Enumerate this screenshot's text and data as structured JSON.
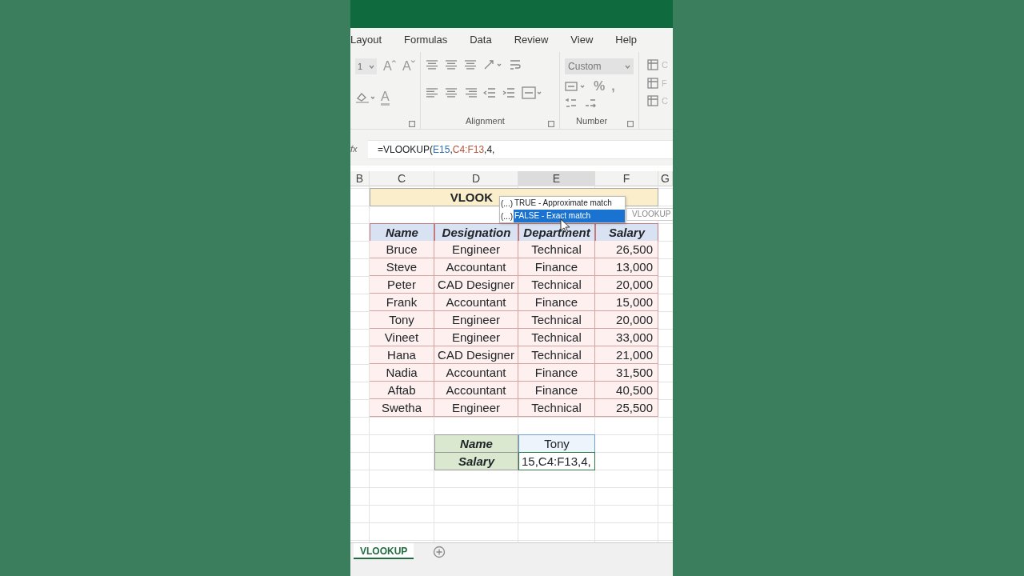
{
  "ribbon_tabs": [
    {
      "label": "Layout"
    },
    {
      "label": "Formulas"
    },
    {
      "label": "Data"
    },
    {
      "label": "Review"
    },
    {
      "label": "View"
    },
    {
      "label": "Help"
    }
  ],
  "ribbon": {
    "font_size": "1",
    "font_glyphs": [
      "Aˆ",
      "Aˇ"
    ],
    "font_color_glyph": "A",
    "number_format": "Custom",
    "number_glyphs": [
      "%",
      ","
    ],
    "group_labels": [
      "Alignment",
      "Number"
    ],
    "style_letters": [
      "C",
      "F",
      "C"
    ]
  },
  "formula_bar": {
    "fx": "fx",
    "parts": [
      {
        "text": "=VLOOKUP("
      },
      {
        "text": "E15",
        "color": "#2e6db4"
      },
      {
        "text": ","
      },
      {
        "text": "C4:F13",
        "color": "#b4543a"
      },
      {
        "text": ",4,"
      }
    ]
  },
  "column_headers": [
    {
      "label": "B",
      "selected": false
    },
    {
      "label": "C",
      "selected": false
    },
    {
      "label": "D",
      "selected": false
    },
    {
      "label": "E",
      "selected": true
    },
    {
      "label": "F",
      "selected": false
    },
    {
      "label": "G",
      "selected": false
    }
  ],
  "title_cell": "VLOOK",
  "autocomplete": {
    "options": [
      {
        "icon": "(...)",
        "label": "TRUE - Approximate match",
        "selected": false
      },
      {
        "icon": "(...)",
        "label": "FALSE - Exact match",
        "selected": true
      }
    ],
    "tooltip": "VLOOKUP"
  },
  "table": {
    "columns": [
      "Name",
      "Designation",
      "Department",
      "Salary"
    ],
    "rows": [
      [
        "Bruce",
        "Engineer",
        "Technical",
        "26,500"
      ],
      [
        "Steve",
        "Accountant",
        "Finance",
        "13,000"
      ],
      [
        "Peter",
        "CAD Designer",
        "Technical",
        "20,000"
      ],
      [
        "Frank",
        "Accountant",
        "Finance",
        "15,000"
      ],
      [
        "Tony",
        "Engineer",
        "Technical",
        "20,000"
      ],
      [
        "Vineet",
        "Engineer",
        "Technical",
        "33,000"
      ],
      [
        "Hana",
        "CAD Designer",
        "Technical",
        "21,000"
      ],
      [
        "Nadia",
        "Accountant",
        "Finance",
        "31,500"
      ],
      [
        "Aftab",
        "Accountant",
        "Finance",
        "40,500"
      ],
      [
        "Swetha",
        "Engineer",
        "Technical",
        "25,500"
      ]
    ]
  },
  "lookup": [
    {
      "label": "Name",
      "value": "Tony",
      "editing": false
    },
    {
      "label": "Salary",
      "value": "15,C4:F13,4,",
      "editing": true
    }
  ],
  "sheet_tabs": [
    {
      "label": "VLOOKUP",
      "selected": true
    }
  ]
}
